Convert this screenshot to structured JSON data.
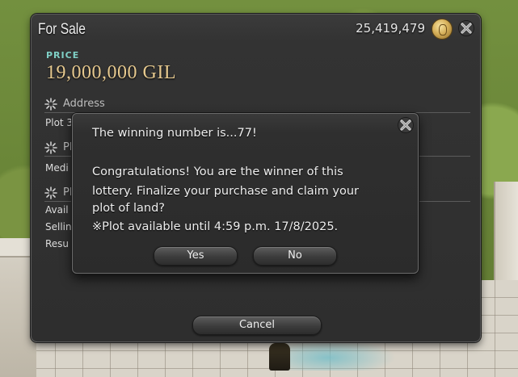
{
  "window": {
    "title": "For Sale",
    "gil_amount": "25,419,479",
    "price_label": "PRICE",
    "price_value": "19,000,000 GIL",
    "sections": [
      {
        "title": "Address",
        "rows": [
          "Plot 3"
        ]
      },
      {
        "title": "Pl",
        "rows": [
          "Medi"
        ]
      },
      {
        "title": "Pl",
        "rows": [
          "Avail",
          "Sellin",
          "Resu"
        ]
      }
    ],
    "cancel_label": "Cancel"
  },
  "dialog": {
    "lines": [
      "The winning number is...77!",
      "",
      "Congratulations! You are the winner of this",
      "lottery. Finalize your purchase and claim your",
      "plot of land?",
      "※Plot available until 4:59 p.m. 17/8/2025."
    ],
    "yes_label": "Yes",
    "no_label": "No"
  },
  "icons": {
    "close": "close-icon",
    "coin": "gil-coin-icon",
    "section": "sparkle-icon"
  },
  "colors": {
    "price_label": "#7fd0c6",
    "price_value": "#e6c98f",
    "panel": "#2e2e2e"
  }
}
